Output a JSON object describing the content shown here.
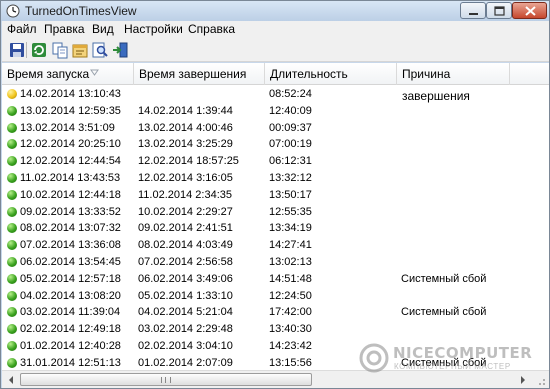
{
  "window": {
    "title": "TurnedOnTimesView",
    "colors": {
      "title_bar": "#c7d7ea",
      "close_button": "#c6472d"
    }
  },
  "menubar": {
    "items": [
      {
        "label": "Файл"
      },
      {
        "label": "Правка"
      },
      {
        "label": "Вид"
      },
      {
        "label": "Настройки"
      },
      {
        "label": "Справка"
      }
    ]
  },
  "toolbar": {
    "buttons": [
      {
        "icon": "save-icon"
      },
      {
        "icon": "refresh-icon"
      },
      {
        "icon": "copy-icon"
      },
      {
        "icon": "properties-icon"
      },
      {
        "icon": "find-icon"
      },
      {
        "icon": "exit-icon"
      }
    ]
  },
  "table": {
    "columns": [
      "Время запуска",
      "Время завершения",
      "Длительность",
      "Причина завершения"
    ],
    "rows": [
      {
        "status": "yellow",
        "start": "14.02.2014 13:10:43",
        "end": "",
        "duration": "08:52:24",
        "reason": ""
      },
      {
        "status": "green",
        "start": "13.02.2014 12:59:35",
        "end": "14.02.2014 1:39:44",
        "duration": "12:40:09",
        "reason": ""
      },
      {
        "status": "green",
        "start": "13.02.2014 3:51:09",
        "end": "13.02.2014 4:00:46",
        "duration": "00:09:37",
        "reason": ""
      },
      {
        "status": "green",
        "start": "12.02.2014 20:25:10",
        "end": "13.02.2014 3:25:29",
        "duration": "07:00:19",
        "reason": ""
      },
      {
        "status": "green",
        "start": "12.02.2014 12:44:54",
        "end": "12.02.2014 18:57:25",
        "duration": "06:12:31",
        "reason": ""
      },
      {
        "status": "green",
        "start": "11.02.2014 13:43:53",
        "end": "12.02.2014 3:16:05",
        "duration": "13:32:12",
        "reason": ""
      },
      {
        "status": "green",
        "start": "10.02.2014 12:44:18",
        "end": "11.02.2014 2:34:35",
        "duration": "13:50:17",
        "reason": ""
      },
      {
        "status": "green",
        "start": "09.02.2014 13:33:52",
        "end": "10.02.2014 2:29:27",
        "duration": "12:55:35",
        "reason": ""
      },
      {
        "status": "green",
        "start": "08.02.2014 13:07:32",
        "end": "09.02.2014 2:41:51",
        "duration": "13:34:19",
        "reason": ""
      },
      {
        "status": "green",
        "start": "07.02.2014 13:36:08",
        "end": "08.02.2014 4:03:49",
        "duration": "14:27:41",
        "reason": ""
      },
      {
        "status": "green",
        "start": "06.02.2014 13:54:45",
        "end": "07.02.2014 2:56:58",
        "duration": "13:02:13",
        "reason": ""
      },
      {
        "status": "green",
        "start": "05.02.2014 12:57:18",
        "end": "06.02.2014 3:49:06",
        "duration": "14:51:48",
        "reason": "Системный сбой"
      },
      {
        "status": "green",
        "start": "04.02.2014 13:08:20",
        "end": "05.02.2014 1:33:10",
        "duration": "12:24:50",
        "reason": ""
      },
      {
        "status": "green",
        "start": "03.02.2014 11:39:04",
        "end": "04.02.2014 5:21:04",
        "duration": "17:42:00",
        "reason": "Системный сбой"
      },
      {
        "status": "green",
        "start": "02.02.2014 12:49:18",
        "end": "03.02.2014 2:29:48",
        "duration": "13:40:30",
        "reason": ""
      },
      {
        "status": "green",
        "start": "01.02.2014 12:40:28",
        "end": "02.02.2014 3:04:10",
        "duration": "14:23:42",
        "reason": ""
      },
      {
        "status": "green",
        "start": "31.01.2014 12:51:13",
        "end": "01.02.2014 2:07:09",
        "duration": "13:15:56",
        "reason": "Системный сбой"
      }
    ]
  },
  "watermark": {
    "name": "NICECOMPUTER",
    "tagline": "КОМПЬЮТЕРНЫЙ МАСТЕР"
  }
}
